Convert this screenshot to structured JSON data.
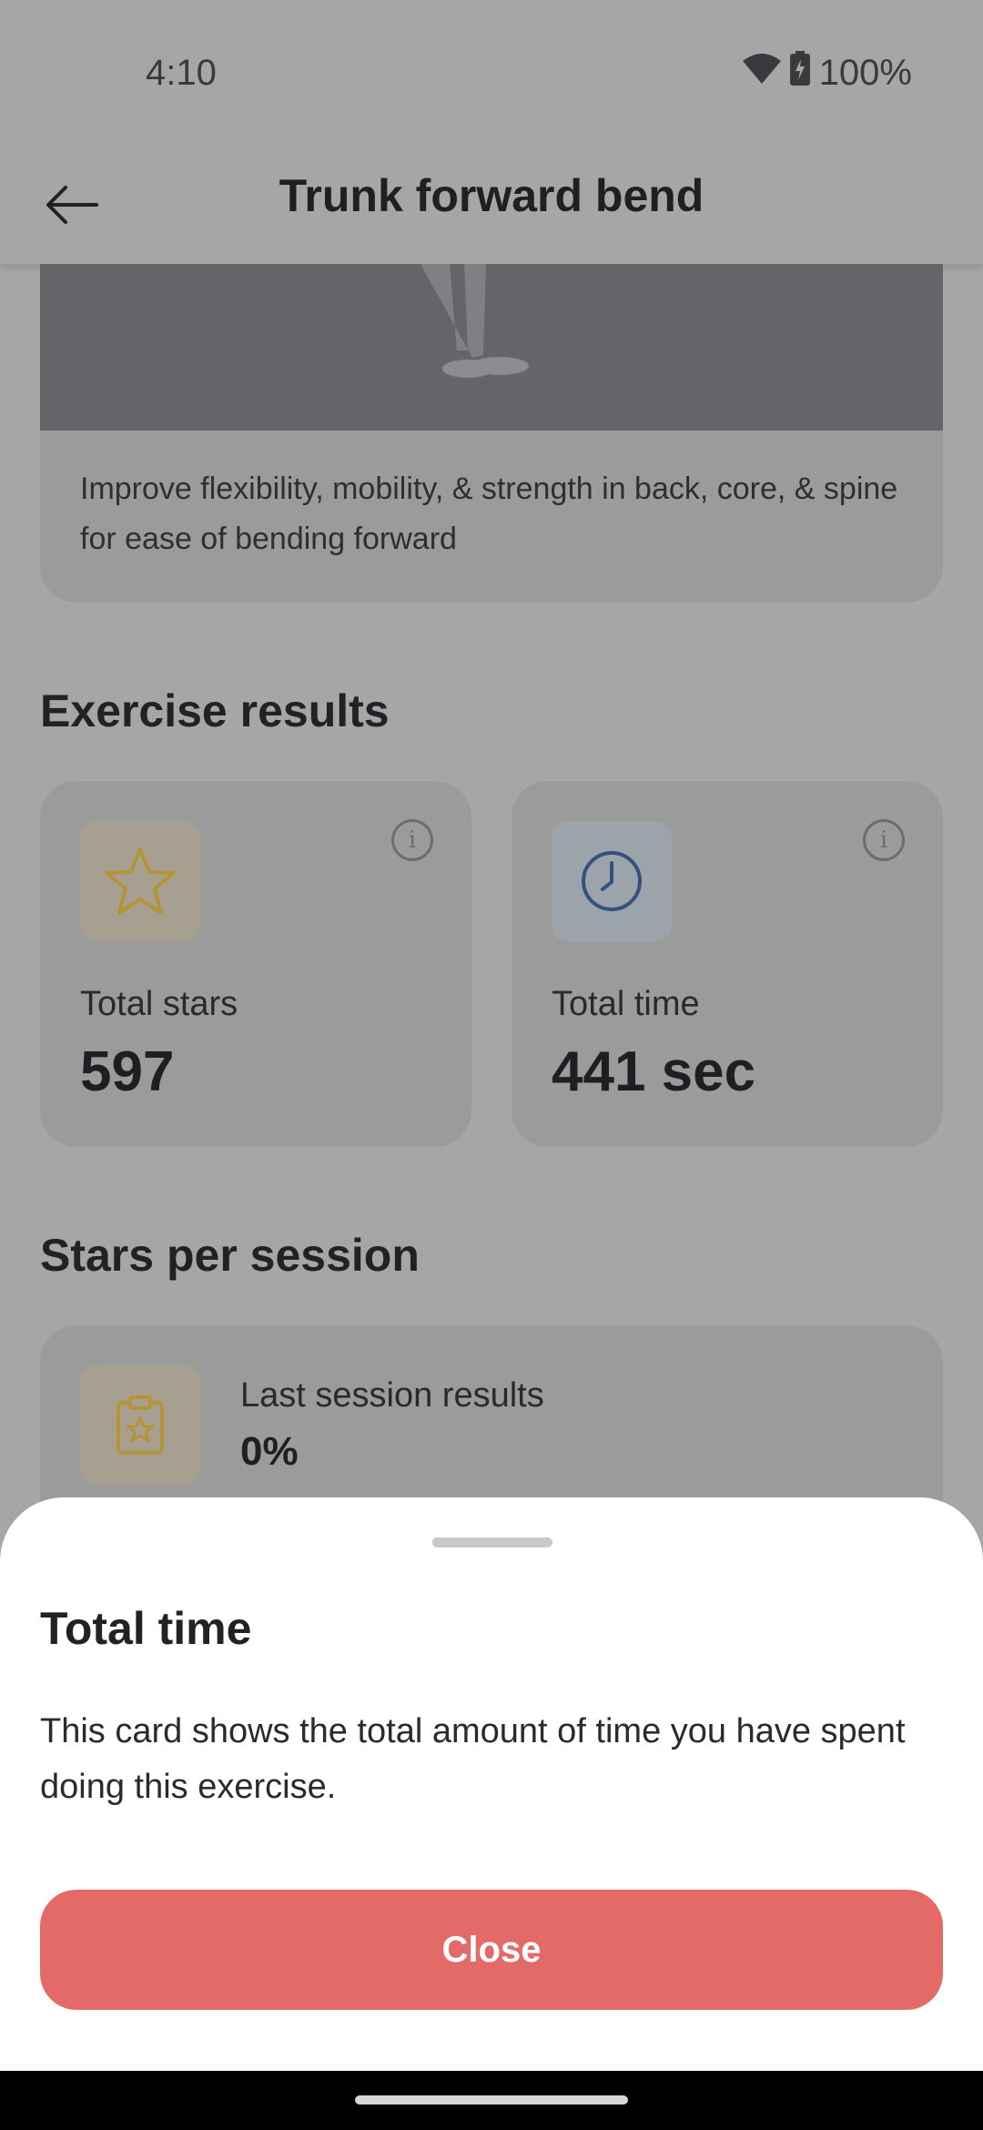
{
  "status_bar": {
    "time": "4:10",
    "battery": "100%"
  },
  "app_bar": {
    "title": "Trunk forward bend"
  },
  "hero": {
    "description": "Improve flexibility, mobility, & strength in back, core, & spine for ease of bending forward"
  },
  "results": {
    "section_title": "Exercise results",
    "cards": [
      {
        "label": "Total stars",
        "value": "597",
        "icon": "star-icon"
      },
      {
        "label": "Total time",
        "value": "441 sec",
        "icon": "clock-icon"
      }
    ]
  },
  "stars_per_session": {
    "section_title": "Stars per session",
    "last_session_label": "Last session results",
    "last_session_value": "0%"
  },
  "sheet": {
    "title": "Total time",
    "body": "This card shows the total amount of time you have spent doing this exercise.",
    "close_label": "Close"
  },
  "colors": {
    "accent": "#e46a68",
    "star": "#c9a040",
    "clock": "#3d5a7e"
  }
}
